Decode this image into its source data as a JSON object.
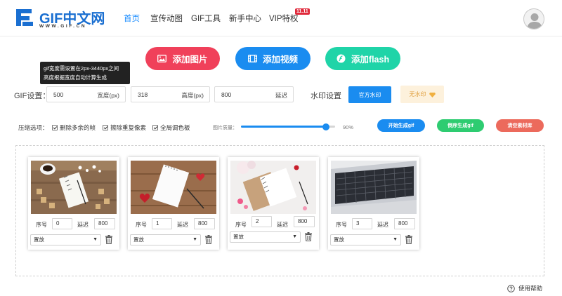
{
  "brand": {
    "logo_text": "GIF中文网",
    "logo_sub": "WWW.GIF.CN",
    "primary": "#1a6fd1"
  },
  "nav": {
    "items": [
      {
        "label": "首页",
        "active": true
      },
      {
        "label": "宣传动图"
      },
      {
        "label": "GIF工具"
      },
      {
        "label": "新手中心"
      },
      {
        "label": "VIP特权"
      }
    ],
    "vip_badge": "11.11"
  },
  "actions": {
    "add_image": "添加图片",
    "add_video": "添加视频",
    "add_flash": "添加flash"
  },
  "tooltip": {
    "line1": "gif宽度需设置在2px-3440px之间",
    "line2": "高度根据宽度自动计算生成"
  },
  "gif_settings": {
    "label": "GIF设置：",
    "width_value": "500",
    "width_unit": "宽度(px)",
    "height_value": "318",
    "height_unit": "高度(px)",
    "delay_value": "800",
    "delay_unit": "延迟",
    "watermark_label": "水印设置",
    "official_watermark": "官方水印",
    "no_watermark": "无水印"
  },
  "compress": {
    "label": "压缩选项：",
    "options": [
      "删除多余的帧",
      "擦除重复像素",
      "全局调色板"
    ],
    "quality_label": "图片质量：",
    "quality_value": 90,
    "quality_text": "90%"
  },
  "buttons": {
    "start": "开始生成gif",
    "reverse": "倒序生成gif",
    "clear": "清空素材库"
  },
  "frames": [
    {
      "seq_label": "序号",
      "seq": "0",
      "delay_label": "延迟",
      "delay": "800",
      "select": "置放"
    },
    {
      "seq_label": "序号",
      "seq": "1",
      "delay_label": "延迟",
      "delay": "800",
      "select": "置放"
    },
    {
      "seq_label": "序号",
      "seq": "2",
      "delay_label": "延迟",
      "delay": "800",
      "select": "置放"
    },
    {
      "seq_label": "序号",
      "seq": "3",
      "delay_label": "延迟",
      "delay": "800",
      "select": "置放"
    }
  ],
  "help": "使用帮助"
}
